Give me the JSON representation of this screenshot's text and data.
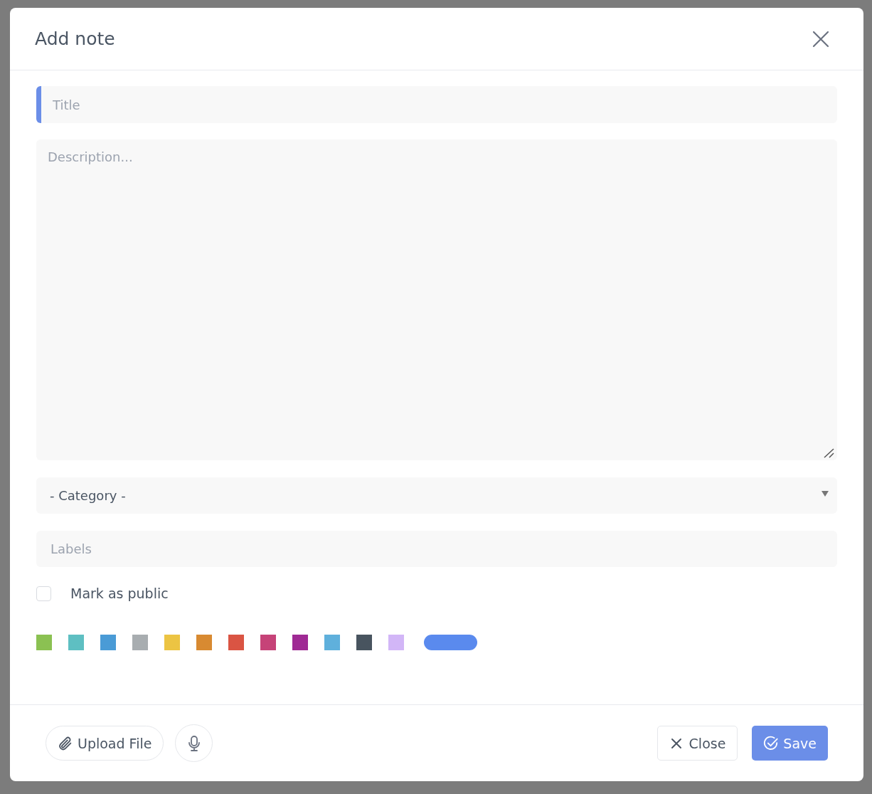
{
  "dialog": {
    "title": "Add note"
  },
  "fields": {
    "title_placeholder": "Title",
    "description_placeholder": "Description...",
    "category": "- Category -",
    "labels_placeholder": "Labels"
  },
  "public": {
    "label": "Mark as public",
    "checked": false
  },
  "colors": [
    {
      "kind": "swatch",
      "color": "#8bc152"
    },
    {
      "kind": "swatch",
      "color": "#5ebfc2"
    },
    {
      "kind": "swatch",
      "color": "#4a9bd6"
    },
    {
      "kind": "swatch",
      "color": "#a8adb0"
    },
    {
      "kind": "swatch",
      "color": "#ecc443"
    },
    {
      "kind": "swatch",
      "color": "#d88a31"
    },
    {
      "kind": "swatch",
      "color": "#da5443"
    },
    {
      "kind": "swatch",
      "color": "#c64378"
    },
    {
      "kind": "swatch",
      "color": "#9f2a94"
    },
    {
      "kind": "swatch",
      "color": "#5fb0dc"
    },
    {
      "kind": "swatch",
      "color": "#48545f"
    },
    {
      "kind": "swatch",
      "color": "#d2b6f7"
    },
    {
      "kind": "bar",
      "color": "#5a8aee"
    }
  ],
  "footer": {
    "upload": "Upload File",
    "close": "Close",
    "save": "Save"
  }
}
